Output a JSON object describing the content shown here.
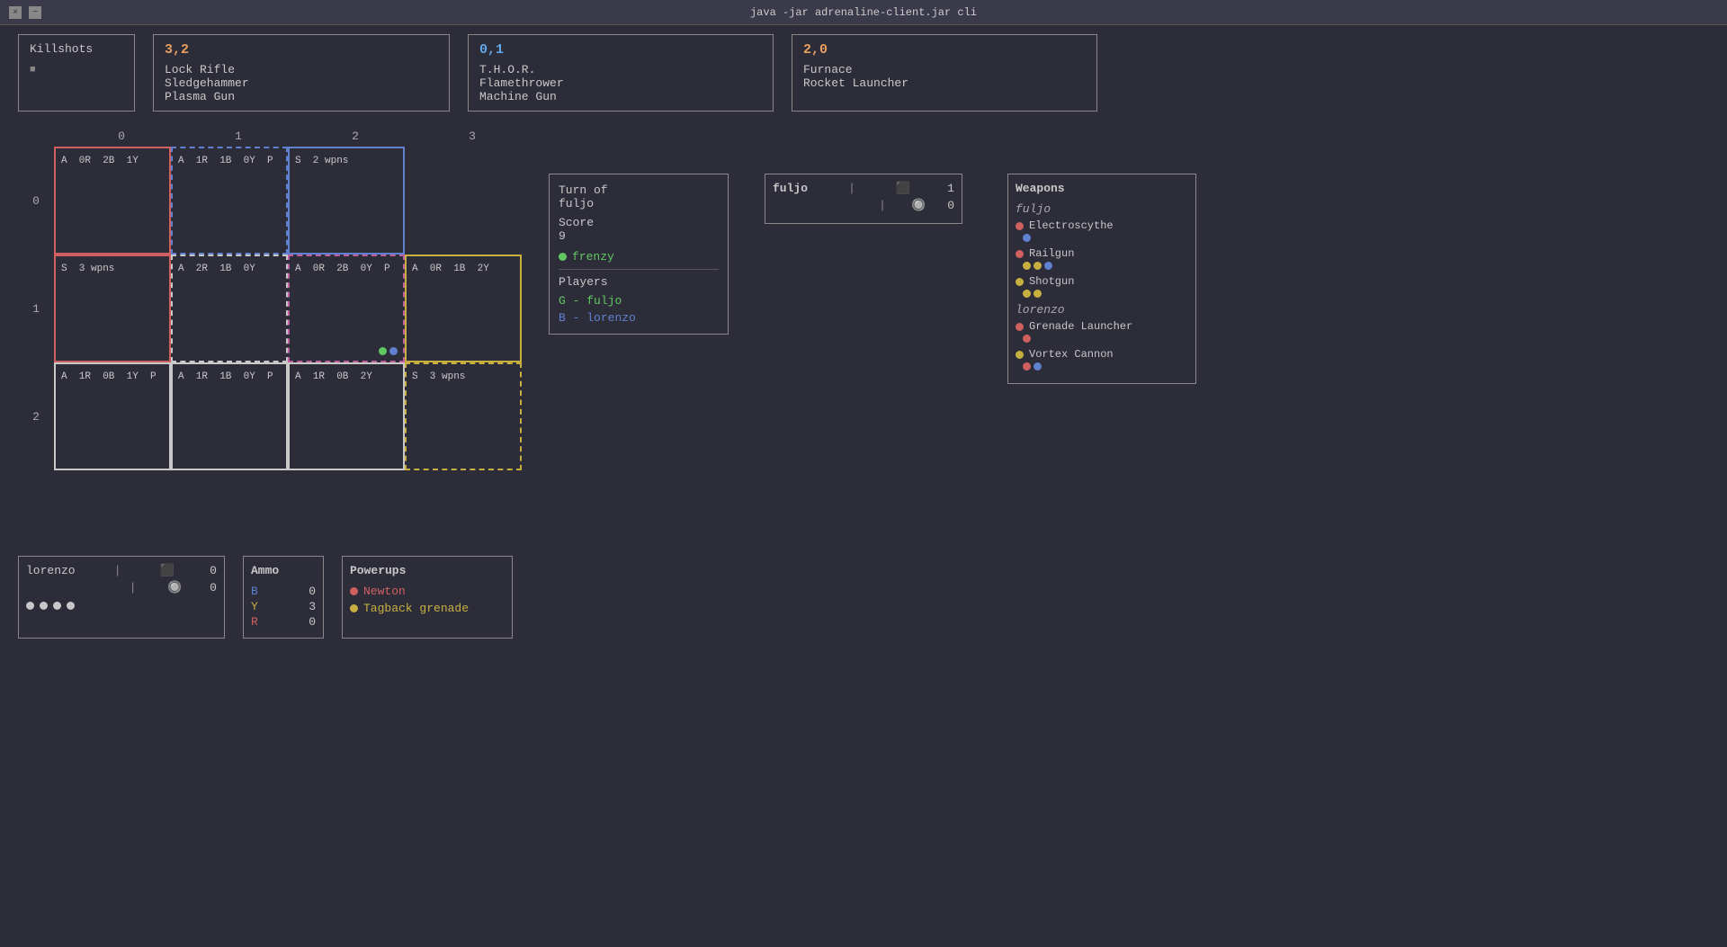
{
  "titlebar": {
    "title": "java -jar adrenaline-client.jar cli",
    "close_btn": "×",
    "min_btn": "−"
  },
  "top_panels": {
    "killshots": {
      "title": "Killshots",
      "marker": "■"
    },
    "player1": {
      "score": "3,2",
      "weapons": [
        "Lock Rifle",
        "Sledgehammer",
        "Plasma Gun"
      ]
    },
    "player2": {
      "score": "0,1",
      "weapons": [
        "T.H.O.R.",
        "Flamethrower",
        "Machine Gun"
      ]
    },
    "player3": {
      "score": "2,0",
      "weapons": [
        "Furnace",
        "Rocket Launcher"
      ]
    }
  },
  "grid": {
    "col_labels": [
      "0",
      "1",
      "2",
      "3"
    ],
    "row_labels": [
      "0",
      "1",
      "2"
    ],
    "cells": [
      {
        "row": 0,
        "col": 0,
        "style": "red",
        "text": "A  0R  2B  1Y",
        "players": []
      },
      {
        "row": 0,
        "col": 1,
        "style": "blue-dashed",
        "text": "A  1R  1B  0Y  P",
        "players": []
      },
      {
        "row": 0,
        "col": 2,
        "style": "blue",
        "text": "S  2 wpns",
        "players": []
      },
      {
        "row": 0,
        "col": 3,
        "style": "none",
        "text": "",
        "players": []
      },
      {
        "row": 1,
        "col": 0,
        "style": "red",
        "text": "S  3 wpns",
        "players": []
      },
      {
        "row": 1,
        "col": 1,
        "style": "white-dashed",
        "text": "A  2R  1B  0Y",
        "players": []
      },
      {
        "row": 1,
        "col": 2,
        "style": "pink-dashed",
        "text": "A  0R  2B  0Y  P",
        "players": [
          "green",
          "blue"
        ]
      },
      {
        "row": 1,
        "col": 3,
        "style": "yellow",
        "text": "A  0R  1B  2Y",
        "players": []
      },
      {
        "row": 2,
        "col": 0,
        "style": "white",
        "text": "A  1R  0B  1Y  P",
        "players": []
      },
      {
        "row": 2,
        "col": 1,
        "style": "white",
        "text": "A  1R  1B  0Y  P",
        "players": []
      },
      {
        "row": 2,
        "col": 2,
        "style": "white",
        "text": "A  1R  0B  2Y",
        "players": []
      },
      {
        "row": 2,
        "col": 3,
        "style": "yellow-dashed",
        "text": "S  3 wpns",
        "players": []
      }
    ]
  },
  "turn_panel": {
    "turn_of_label": "Turn of",
    "player": "fuljo",
    "score_label": "Score",
    "score": "9",
    "frenzy_label": "frenzy",
    "players_label": "Players",
    "players": [
      {
        "color": "G",
        "name": "fuljo"
      },
      {
        "color": "B",
        "name": "lorenzo"
      }
    ]
  },
  "fuljo_panel": {
    "name": "fuljo",
    "separator": "|",
    "skull_val": "1",
    "drop_val": "0",
    "skulls_row2": "|",
    "drop_row2": "0"
  },
  "weapons_panel": {
    "title": "Weapons",
    "owners": [
      {
        "name": "fuljo",
        "weapons": [
          {
            "dot": "red",
            "name": "Electroscythe",
            "ammo": [
              "blue"
            ]
          },
          {
            "dot": "red",
            "name": "Railgun",
            "ammo": [
              "yellow",
              "yellow",
              "blue"
            ]
          },
          {
            "dot": "yellow",
            "name": "Shotgun",
            "ammo": [
              "yellow",
              "yellow"
            ]
          }
        ]
      },
      {
        "name": "lorenzo",
        "weapons": [
          {
            "dot": "red",
            "name": "Grenade Launcher",
            "ammo": [
              "red"
            ]
          },
          {
            "dot": "yellow",
            "name": "Vortex Cannon",
            "ammo": [
              "red",
              "blue"
            ]
          }
        ]
      }
    ]
  },
  "lorenzo_panel": {
    "name": "lorenzo",
    "separator": "|",
    "skull_val": "0",
    "drop_val": "0",
    "dots": [
      "white",
      "white",
      "white",
      "white"
    ]
  },
  "ammo_panel": {
    "title": "Ammo",
    "rows": [
      {
        "color": "B",
        "value": "0",
        "color_hex": "#6080d0"
      },
      {
        "color": "Y",
        "value": "3",
        "color_hex": "#c8b040"
      },
      {
        "color": "R",
        "value": "0",
        "color_hex": "#d06060"
      }
    ]
  },
  "powerups_panel": {
    "title": "Powerups",
    "items": [
      {
        "dot_color": "red",
        "name": "Newton"
      },
      {
        "dot_color": "yellow",
        "name": "Tagback grenade"
      }
    ]
  }
}
